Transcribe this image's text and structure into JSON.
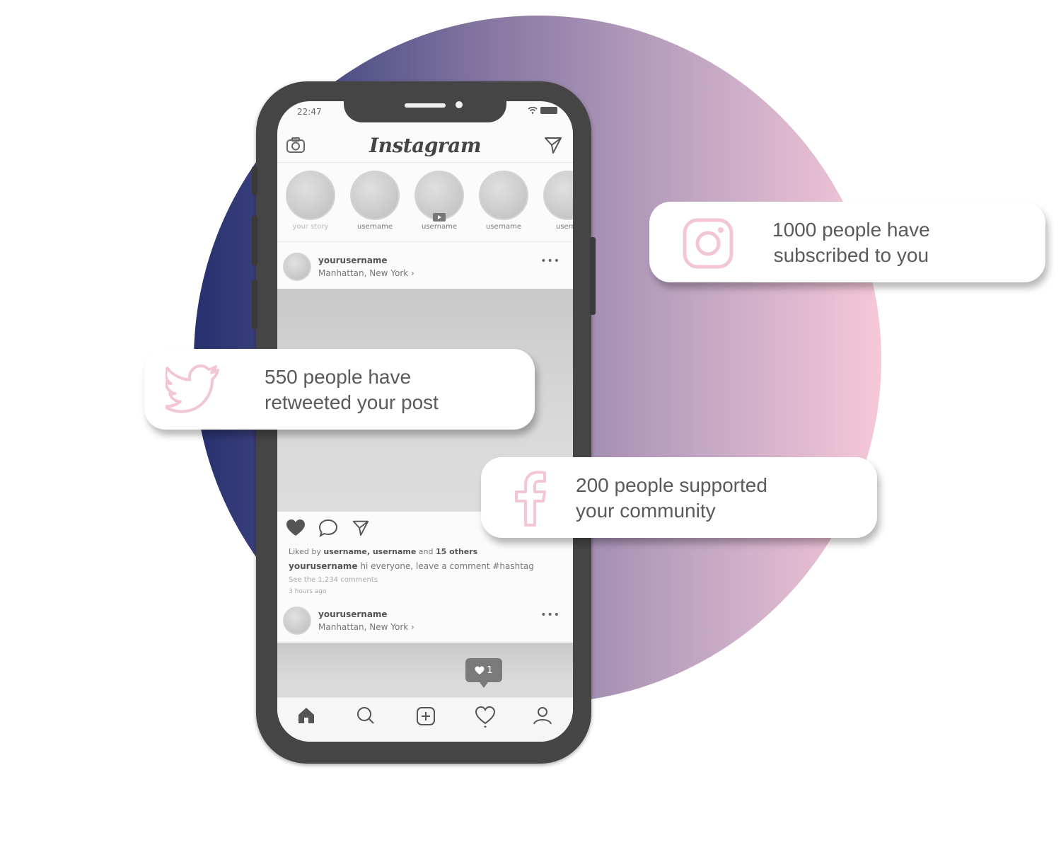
{
  "status_bar": {
    "time": "22:47"
  },
  "app": {
    "logo": "Instagram"
  },
  "stories": [
    {
      "label": "your story"
    },
    {
      "label": "username"
    },
    {
      "label": "username"
    },
    {
      "label": "username"
    },
    {
      "label": "userna"
    }
  ],
  "posts": [
    {
      "username": "yourusername",
      "location": "Manhattan, New York ›",
      "more": "•••"
    },
    {
      "username": "yourusername",
      "location": "Manhattan, New York ›",
      "more": "•••"
    }
  ],
  "caption": {
    "liked_prefix": "Liked by ",
    "liked_users": "username, username",
    "liked_and": " and ",
    "liked_others": "15 others",
    "author": "yourusername",
    "text": " hi everyone, leave a comment #hashtag",
    "comments_link": "See the 1,234 comments",
    "time_ago": "3 hours ago"
  },
  "notification_badge": {
    "count": "1"
  },
  "cards": [
    {
      "platform_icon": "instagram-icon",
      "message": "1000 people have\nsubscribed to you"
    },
    {
      "platform_icon": "twitter-icon",
      "message": "550 people have\nretweeted your post"
    },
    {
      "platform_icon": "facebook-icon",
      "message": "200 people supported\nyour community"
    }
  ],
  "colors": {
    "icon_pink": "#f2c6d6",
    "gradient_start": "#27306f",
    "gradient_end": "#f6c8d8",
    "phone_frame": "#454545"
  }
}
